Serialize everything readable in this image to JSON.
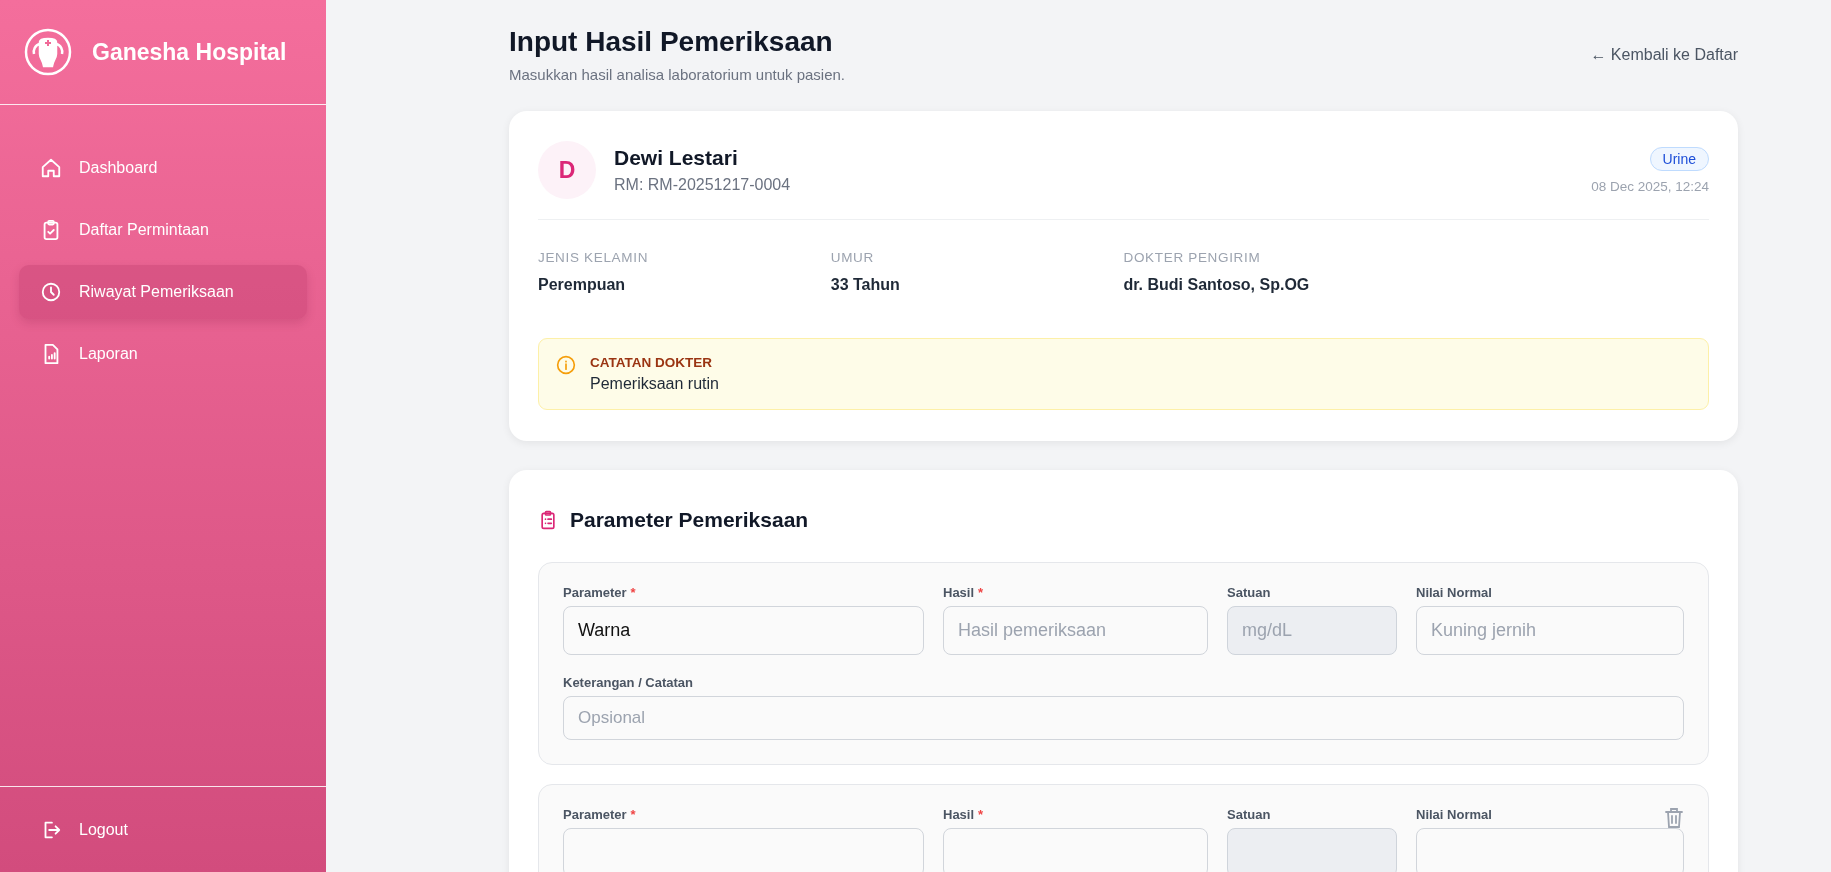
{
  "sidebar": {
    "brand": "Ganesha Hospital",
    "items": [
      {
        "label": "Dashboard",
        "selected": false
      },
      {
        "label": "Daftar Permintaan",
        "selected": false
      },
      {
        "label": "Riwayat Pemeriksaan",
        "selected": true
      },
      {
        "label": "Laporan",
        "selected": false
      }
    ],
    "logout": "Logout"
  },
  "header": {
    "title": "Input Hasil Pemeriksaan",
    "subtitle": "Masukkan hasil analisa laboratorium untuk pasien.",
    "back_link": "← Kembali ke Daftar"
  },
  "patient": {
    "initial": "D",
    "name": "Dewi Lestari",
    "rm": "RM: RM-20251217-0004",
    "sample_type": "Urine",
    "datetime": "08 Dec 2025, 12:24",
    "info": [
      {
        "label": "JENIS KELAMIN",
        "value": "Perempuan"
      },
      {
        "label": "UMUR",
        "value": "33 Tahun"
      },
      {
        "label": "DOKTER PENGIRIM",
        "value": "dr. Budi Santoso, Sp.OG"
      }
    ],
    "note": {
      "title": "CATATAN DOKTER",
      "text": "Pemeriksaan rutin"
    }
  },
  "parameters": {
    "title": "Parameter Pemeriksaan",
    "rows": [
      {
        "removable": false,
        "fields": [
          {
            "label": "Parameter",
            "required_mark": "*",
            "value": "Warna",
            "disabled": false
          },
          {
            "label": "Hasil",
            "required_mark": "*",
            "placeholder": "Hasil pemeriksaan",
            "disabled": false
          },
          {
            "label": "Satuan",
            "placeholder": "mg/dL",
            "disabled": true
          },
          {
            "label": "Nilai Normal",
            "placeholder": "Kuning jernih",
            "disabled": false
          }
        ],
        "note": {
          "label": "Keterangan / Catatan",
          "placeholder": "Opsional"
        }
      },
      {
        "removable": true,
        "fields": [
          {
            "label": "Parameter",
            "required_mark": "*",
            "disabled": false
          },
          {
            "label": "Hasil",
            "required_mark": "*",
            "disabled": false
          },
          {
            "label": "Satuan",
            "disabled": true
          },
          {
            "label": "Nilai Normal",
            "disabled": false
          }
        ]
      }
    ]
  }
}
